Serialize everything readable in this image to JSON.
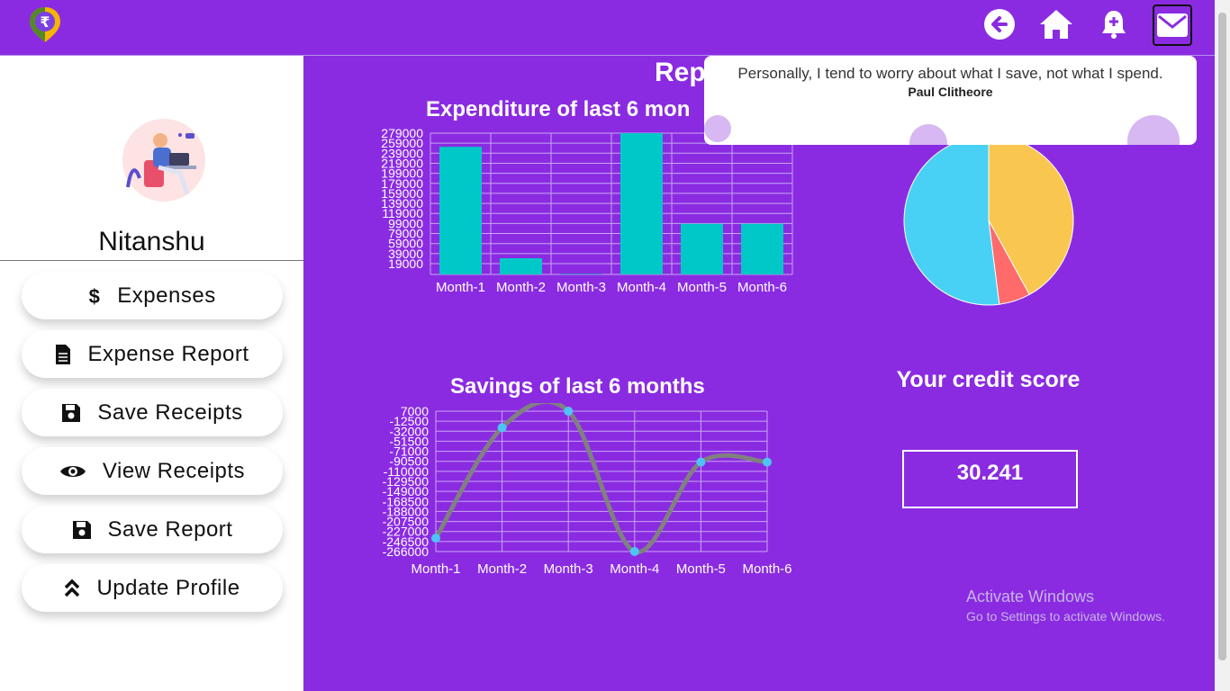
{
  "app": {
    "logo_icon": "rupee-pin-logo"
  },
  "topnav": {
    "icons": [
      "back-arrow-icon",
      "home-icon",
      "add-notification-icon",
      "mail-icon"
    ]
  },
  "profile": {
    "name": "Nitanshu"
  },
  "sidebar": {
    "items": [
      {
        "label": "Expenses",
        "icon": "dollar-icon"
      },
      {
        "label": "Expense Report",
        "icon": "document-icon"
      },
      {
        "label": "Save Receipts",
        "icon": "floppy-disk-icon"
      },
      {
        "label": "View Receipts",
        "icon": "eye-icon"
      },
      {
        "label": "Save Report",
        "icon": "floppy-disk-icon"
      },
      {
        "label": "Update Profile",
        "icon": "double-chevron-up-icon"
      }
    ]
  },
  "main": {
    "title": "Rep"
  },
  "quote": {
    "text": "Personally, I tend to worry about what I save, not what I spend.",
    "author": "Paul Clitheore"
  },
  "credit": {
    "title": "Your credit score",
    "value": "30.241"
  },
  "watermark": {
    "line1": "Activate Windows",
    "line2": "Go to Settings to activate Windows."
  },
  "colors": {
    "accent": "#8a2be2",
    "bar": "#00c8c8",
    "line": "#808080",
    "point": "#4fc3f7",
    "pie": [
      "#f9c74f",
      "#ff6b6b",
      "#48d1f5"
    ]
  },
  "chart_data": [
    {
      "type": "bar",
      "title": "Expenditure of last 6 mon",
      "categories": [
        "Month-1",
        "Month-2",
        "Month-3",
        "Month-4",
        "Month-5",
        "Month-6"
      ],
      "values": [
        252000,
        32000,
        1000,
        279000,
        100000,
        100000
      ],
      "ylim": [
        0,
        279000
      ],
      "yticks": [
        "279000",
        "259000",
        "239000",
        "219000",
        "199000",
        "179000",
        "159000",
        "139000",
        "119000",
        "99000",
        "79000",
        "59000",
        "39000",
        "19000"
      ],
      "grid": true
    },
    {
      "type": "line",
      "title": "Savings of last 6 months",
      "categories": [
        "Month-1",
        "Month-2",
        "Month-3",
        "Month-4",
        "Month-5",
        "Month-6"
      ],
      "values": [
        -240000,
        -25000,
        7000,
        -266000,
        -92000,
        -92000
      ],
      "ylim": [
        -266000,
        7000
      ],
      "yticks": [
        "7000",
        "-12500",
        "-32000",
        "-51500",
        "-71000",
        "-90500",
        "-110000",
        "-129500",
        "-149000",
        "-168500",
        "-188000",
        "-207500",
        "-227000",
        "-246500",
        "-266000"
      ],
      "grid": true
    },
    {
      "type": "pie",
      "values": [
        42,
        6,
        52
      ]
    }
  ]
}
